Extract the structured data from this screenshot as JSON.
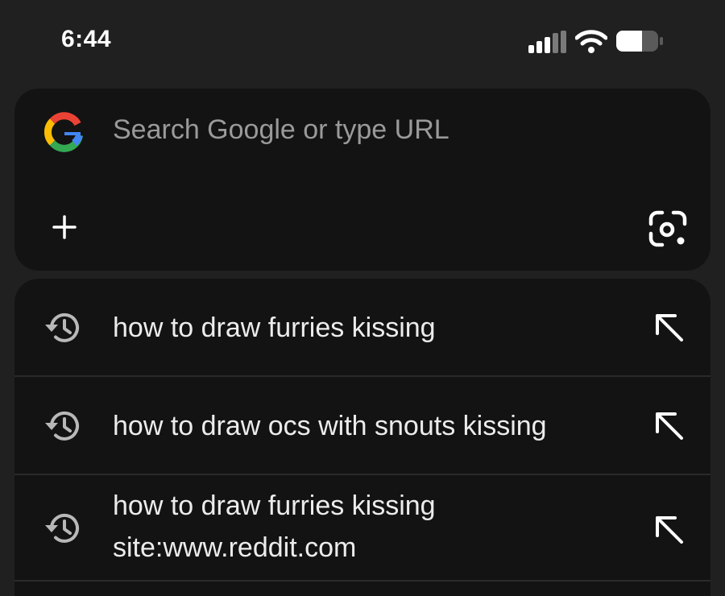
{
  "status_bar": {
    "time": "6:44",
    "icons": [
      "cellular-signal-icon",
      "wifi-icon",
      "battery-icon"
    ]
  },
  "search": {
    "placeholder": "Search Google or type URL",
    "value": "",
    "logo_icon": "google-g-icon",
    "add_icon": "plus-icon",
    "lens_icon": "google-lens-icon"
  },
  "suggestions": [
    {
      "text": "how to draw furries kissing",
      "icon": "history-icon",
      "action_icon": "arrow-up-left-icon"
    },
    {
      "text": "how to draw ocs with snouts kissing",
      "icon": "history-icon",
      "action_icon": "arrow-up-left-icon"
    },
    {
      "text": "how to draw furries kissing site:www.reddit.com",
      "icon": "history-icon",
      "action_icon": "arrow-up-left-icon"
    }
  ],
  "colors": {
    "background": "#202020",
    "card": "#131313",
    "divider": "#2a2a2a",
    "text": "#ececec",
    "placeholder": "#9a9a9a",
    "google_blue": "#4285F4",
    "google_red": "#EA4335",
    "google_yellow": "#FBBC05",
    "google_green": "#34A853"
  }
}
